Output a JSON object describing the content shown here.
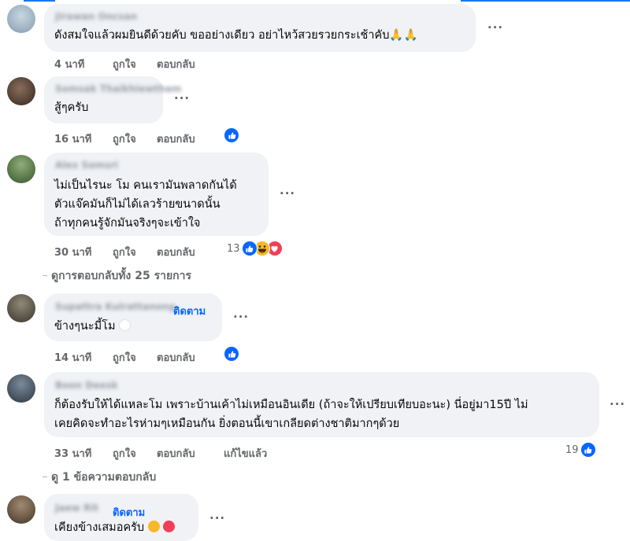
{
  "comments": [
    {
      "author": "Jirawan Oncsan",
      "text_lines": [
        "ดังสมใจแล้วผมยินดีด้วยคับ ขออย่างเดียว อย่าไหว้สวยรวยกระเช้าคับ🙏🙏"
      ],
      "time": "4 นาที",
      "like": "ถูกใจ",
      "reply": "ตอบกลับ",
      "more": "···"
    },
    {
      "author": "Somsak Thaikhiewtham",
      "text_lines": [
        "สู้ๆครับ"
      ],
      "time": "16 นาที",
      "like": "ถูกใจ",
      "reply": "ตอบกลับ",
      "more": "···"
    },
    {
      "author": "Alex Somsri",
      "text_lines": [
        "ไม่เป็นไรนะ โม คนเรามันพลาดกันได้",
        "ตัวแจ๊คมันก็ไม่ได้เลวร้ายขนาดนั้น",
        "ถ้าทุกคนรู้จักมันจริงๆจะเข้าใจ"
      ],
      "time": "30 นาที",
      "like": "ถูกใจ",
      "reply": "ตอบกลับ",
      "more": "···",
      "reaction_count": "13"
    },
    {
      "author": "Supattra Kulrattanong",
      "follow": "ติดตาม",
      "text_lines": [
        "ข้างๆนะมี้โม"
      ],
      "time": "14 นาที",
      "like": "ถูกใจ",
      "reply": "ตอบกลับ",
      "more": "···"
    },
    {
      "author": "Boon Deesk",
      "text_lines": [
        "ก็ต้องรับให้ได้แหละโม เพราะบ้านเค้าไม่เหมือนอินเดีย (ถ้าจะให้เปรียบเทียบอะนะ) นี่อยู่มา15ปี ไม่",
        "เคยคิดจะทำอะไรห่ามๆเหมือนกัน ยิ่งตอนนี้เขาเกลียดต่างชาติมากๆด้วย"
      ],
      "time": "33 นาที",
      "like": "ถูกใจ",
      "reply": "ตอบกลับ",
      "edited": "แก้ไขแล้ว",
      "more": "···",
      "reaction_count": "19"
    },
    {
      "author": "Jaew Rit",
      "follow": "ติดตาม",
      "text_lines": [
        "เคียงข้างเสมอครับ"
      ],
      "more": "···"
    }
  ],
  "threads": {
    "view_replies_25": "ดูการตอบกลับทั้ง 25 รายการ",
    "view_reply_1": "ดู 1 ข้อความตอบกลับ"
  },
  "colors": {
    "like": "#0866ff",
    "haha": "#f7b928",
    "love": "#f33e58",
    "bubble": "#f0f2f5",
    "meta": "#65676b"
  }
}
